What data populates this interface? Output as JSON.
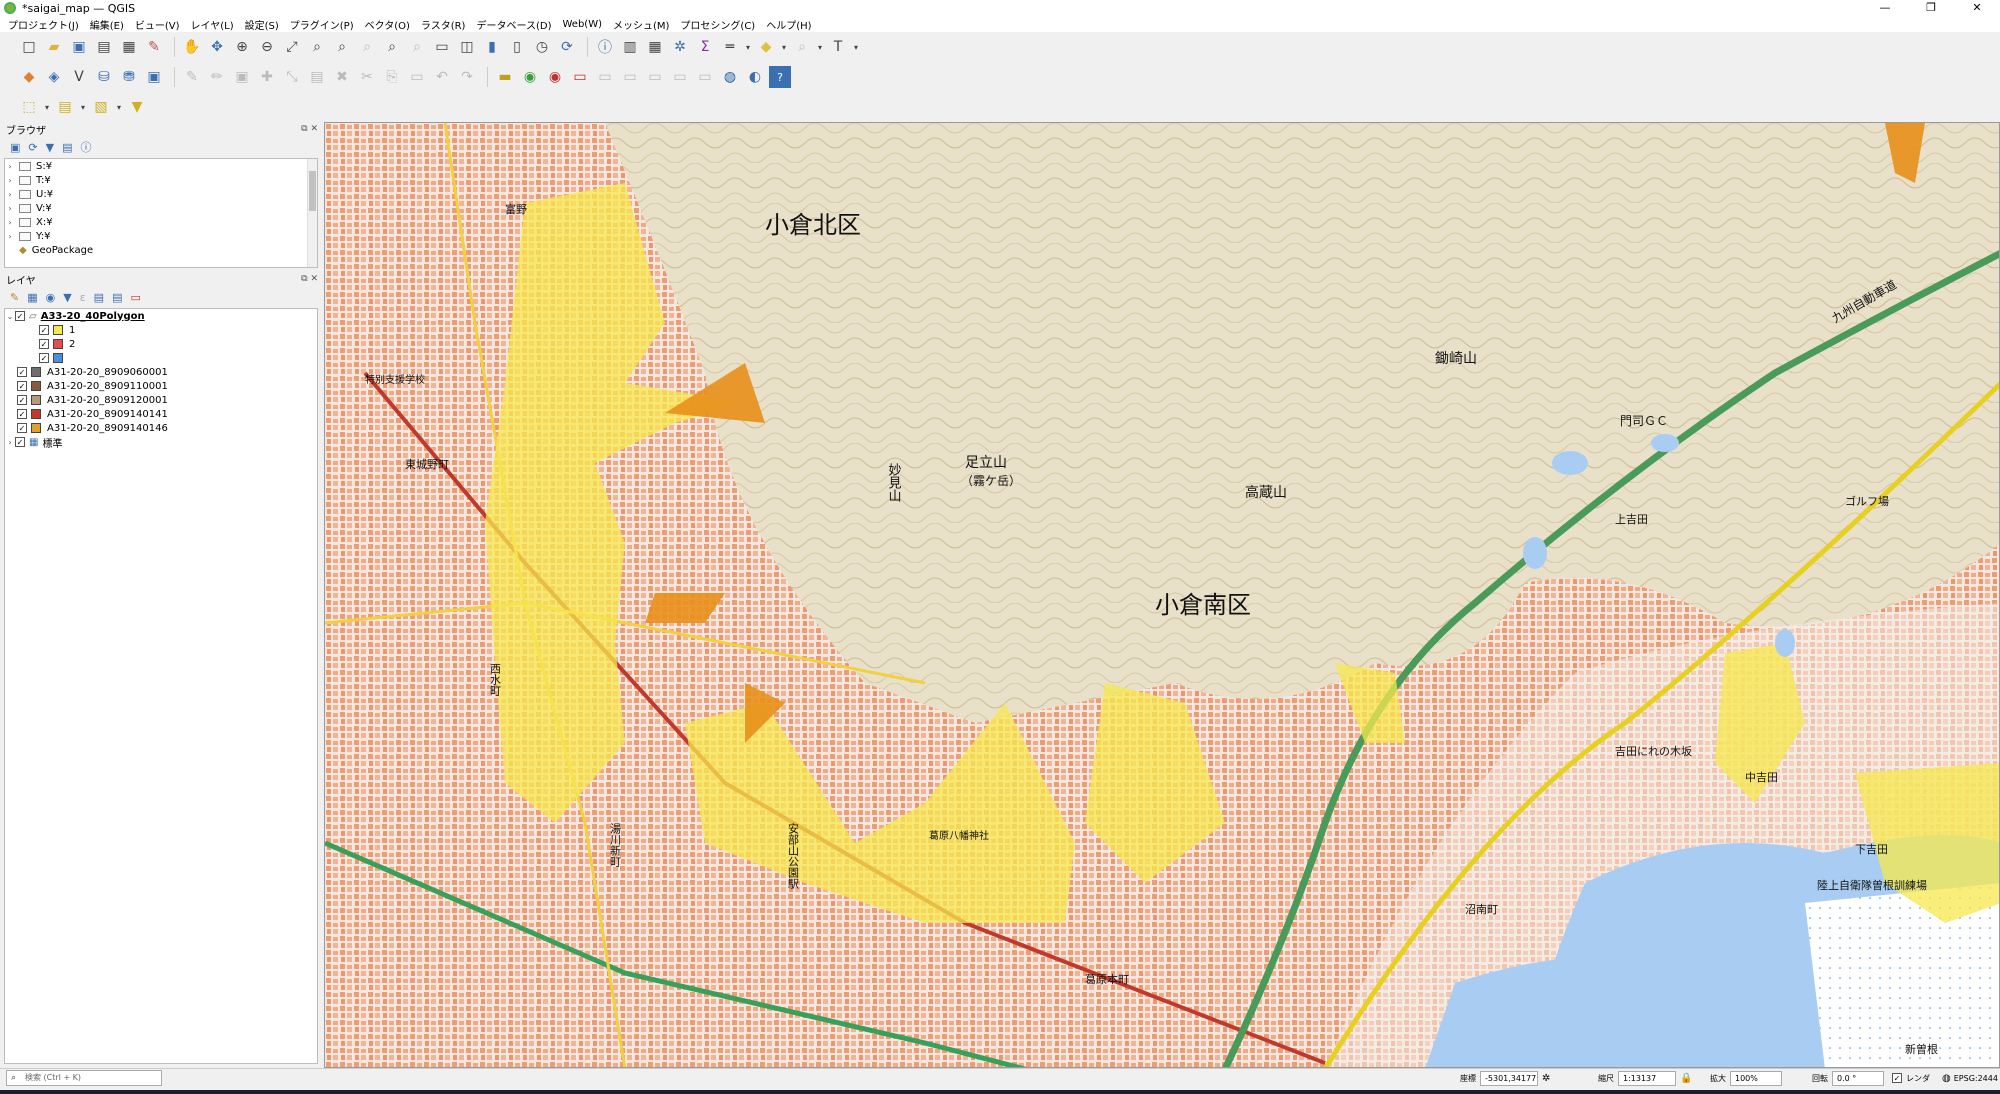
{
  "window": {
    "title": "*saigai_map — QGIS",
    "controls": [
      "—",
      "❐",
      "✕"
    ]
  },
  "menu": [
    "プロジェクト(J)",
    "編集(E)",
    "ビュー(V)",
    "レイヤ(L)",
    "設定(S)",
    "プラグイン(P)",
    "ベクタ(O)",
    "ラスタ(R)",
    "データベース(D)",
    "Web(W)",
    "メッシュ(M)",
    "プロセシング(C)",
    "ヘルプ(H)"
  ],
  "browser": {
    "title": "ブラウザ",
    "items": [
      "S:¥",
      "T:¥",
      "U:¥",
      "V:¥",
      "X:¥",
      "Y:¥",
      "GeoPackage"
    ]
  },
  "layers": {
    "title": "レイヤ",
    "group": {
      "name": "A33-20_40Polygon",
      "classes": [
        {
          "label": "1",
          "color": "#f7e84e"
        },
        {
          "label": "2",
          "color": "#e84c4c"
        },
        {
          "label": "",
          "color": "#4a90d9"
        }
      ]
    },
    "items": [
      {
        "name": "A31-20-20_8909060001",
        "color": "#6e6e6e"
      },
      {
        "name": "A31-20-20_8909110001",
        "color": "#8b5a3c"
      },
      {
        "name": "A31-20-20_8909120001",
        "color": "#b59a7a"
      },
      {
        "name": "A31-20-20_8909140141",
        "color": "#c0392b"
      },
      {
        "name": "A31-20-20_8909140146",
        "color": "#e0a030"
      }
    ],
    "basemap": "標準"
  },
  "map": {
    "labels": {
      "north_ward": "小倉北区",
      "south_ward": "小倉南区",
      "mountain1": "足立山",
      "mountain1_sub": "（霧ケ岳）",
      "mountain2": "高蔵山",
      "mountain3": "鋤崎山",
      "mountain4": "妙見山",
      "golf": "門司ＧＣ",
      "golf2": "ゴルフ場",
      "station1": "安部山公園駅",
      "expressway": "九州自動車道",
      "town1": "東城野町",
      "town2": "上吉田",
      "town3": "沼南町",
      "town4": "葛原本町",
      "town5": "湯川新町",
      "town6": "中吉田",
      "town7": "下吉田",
      "town8": "吉田にれの木坂",
      "town9": "新曽根",
      "jsdf": "陸上自衛隊曽根訓練場",
      "shrine": "葛原八幡神社",
      "school": "特別支援学校",
      "nishiyama": "西水町",
      "tomino": "富野"
    }
  },
  "status": {
    "search_placeholder": "検索 (Ctrl + K)",
    "coord_label": "座標",
    "coord_value": "-5301,34177",
    "scale_label": "縮尺",
    "scale_value": "1:13137",
    "magnifier_label": "拡大",
    "magnifier_value": "100%",
    "rotation_label": "回転",
    "rotation_value": "0.0 °",
    "render_label": "レンダ",
    "crs": "EPSG:2444"
  }
}
